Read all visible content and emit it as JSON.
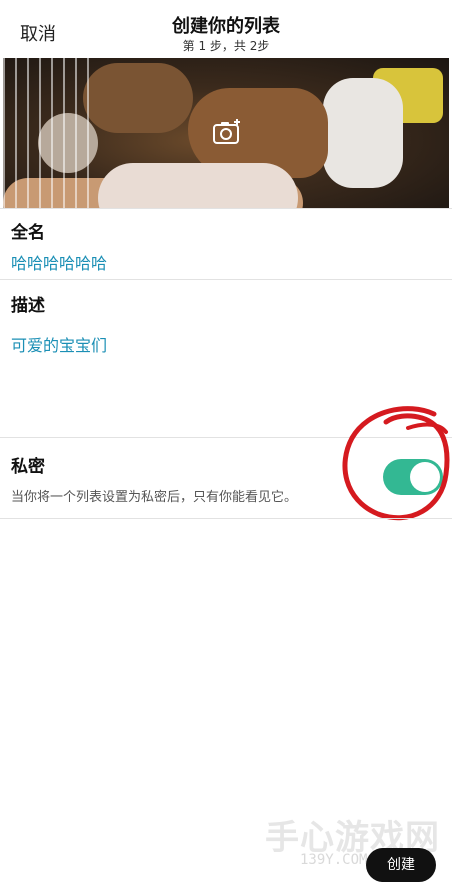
{
  "header": {
    "cancel_label": "取消",
    "title": "创建你的列表",
    "subtitle": "第 1 步，共 2步"
  },
  "banner": {
    "camera_icon": "camera-add-icon"
  },
  "form": {
    "name_label": "全名",
    "name_value": "哈哈哈哈哈哈",
    "desc_label": "描述",
    "desc_value": "可爱的宝宝们",
    "private_label": "私密",
    "private_desc": "当你将一个列表设置为私密后，只有你能看见它。",
    "private_enabled": true
  },
  "footer": {
    "create_label": "创建"
  },
  "watermark": {
    "text": "手心游戏网",
    "sub": "139Y.COM"
  },
  "colors": {
    "accent": "#33b893",
    "link": "#1b8fb5",
    "annotation": "#d51a1f"
  }
}
